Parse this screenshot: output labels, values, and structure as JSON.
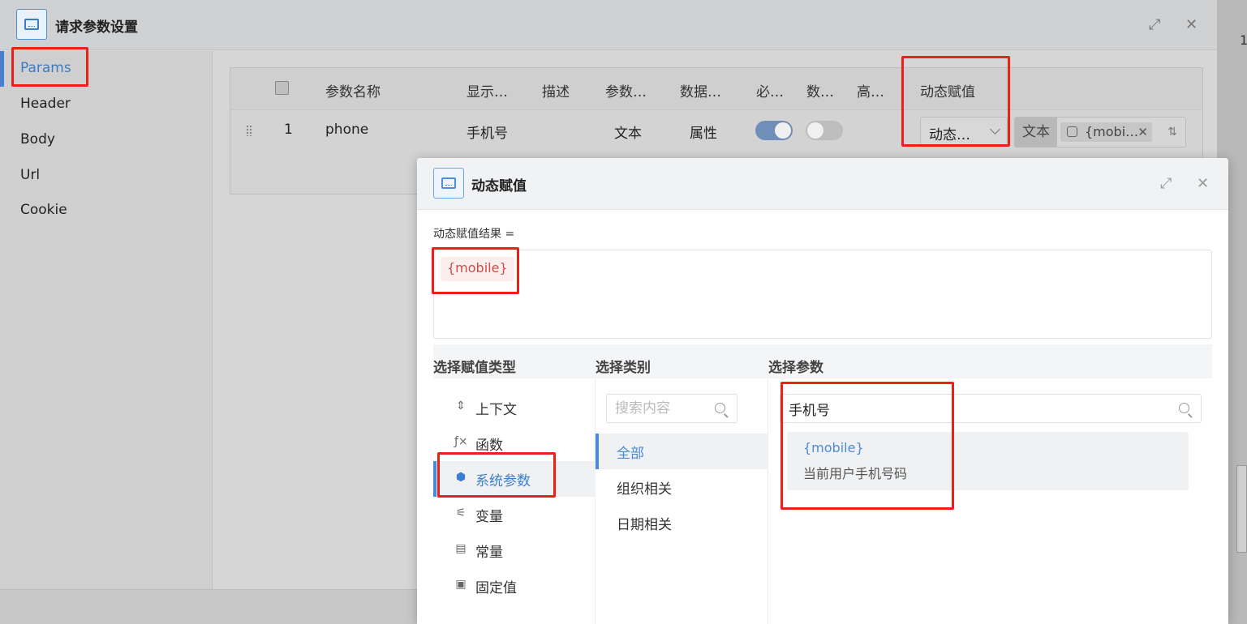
{
  "outer_dialog": {
    "title": "请求参数设置",
    "expand_icon": "⤢",
    "close_icon": "✕"
  },
  "sidebar": {
    "items": [
      {
        "label": "Params",
        "active": true
      },
      {
        "label": "Header"
      },
      {
        "label": "Body"
      },
      {
        "label": "Url"
      },
      {
        "label": "Cookie"
      }
    ]
  },
  "params_table": {
    "headers": [
      "参数名称",
      "显示…",
      "描述",
      "参数…",
      "数据…",
      "必…",
      "数…",
      "高…",
      "动态赋值"
    ],
    "row": {
      "index": "1",
      "name": "phone",
      "display": "手机号",
      "param_type": "文本",
      "data_type": "属性",
      "required": true,
      "array": false,
      "dynamic_select": "动态…",
      "value_type": "文本",
      "value_tag": "{mobi…"
    }
  },
  "inner_dialog": {
    "title": "动态赋值",
    "result_label": "动态赋值结果 =",
    "result_tag": "{mobile}",
    "col_type": "选择赋值类型",
    "col_category": "选择类别",
    "col_param": "选择参数",
    "types": [
      {
        "label": "上下文",
        "icon": "⇕"
      },
      {
        "label": "函数",
        "icon": "ƒ×"
      },
      {
        "label": "系统参数",
        "icon": "⬢",
        "active": true
      },
      {
        "label": "变量",
        "icon": "⚟"
      },
      {
        "label": "常量",
        "icon": "▤"
      },
      {
        "label": "固定值",
        "icon": "▣"
      }
    ],
    "category_search_placeholder": "搜索内容",
    "categories": [
      {
        "label": "全部",
        "active": true
      },
      {
        "label": "组织相关"
      },
      {
        "label": "日期相关"
      }
    ],
    "param_search_value": "手机号",
    "param_result": {
      "code": "{mobile}",
      "desc": "当前用户手机号码"
    }
  },
  "backdrop": {
    "page_number": "1"
  },
  "colors": {
    "accent": "#4b8ad8",
    "highlight": "#e8221b",
    "tag_text": "#c94d4d"
  }
}
